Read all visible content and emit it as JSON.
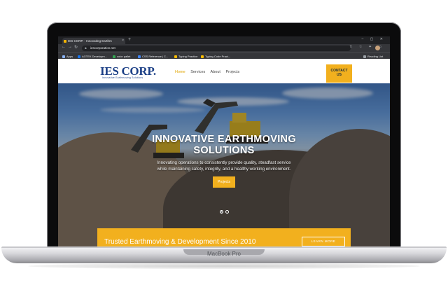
{
  "device": {
    "model": "MacBook Pro"
  },
  "browser": {
    "tab_title": "IES CORP. - Innovating Earthm",
    "new_tab": "+",
    "close": "×",
    "url": "iescorporation.net",
    "bookmarks": [
      {
        "label": "Apps",
        "color": "#8ab4f8"
      },
      {
        "label": "AGTEK Developm...",
        "color": "#1a73e8"
      },
      {
        "label": "color pallet",
        "color": "#34a853"
      },
      {
        "label": "CSS Reference | C...",
        "color": "#4285f4"
      },
      {
        "label": "Typing Practice",
        "color": "#fbbc04"
      },
      {
        "label": "Typing Code Pract...",
        "color": "#fbbc04"
      }
    ],
    "reading_list": "Reading List"
  },
  "site": {
    "logo": "IES CORP.",
    "tagline": "Innovative Earthmoving Solutions",
    "nav": [
      {
        "label": "Home",
        "active": true
      },
      {
        "label": "Services",
        "active": false
      },
      {
        "label": "About",
        "active": false
      },
      {
        "label": "Projects",
        "active": false
      }
    ],
    "contact_line1": "CONTACT",
    "contact_line2": "US",
    "hero": {
      "headline_line1": "INNOVATIVE EARTHMOVING",
      "headline_line2": "SOLUTIONS",
      "sub_line1": "Innovating operations to consistently provide quality, steadfast service",
      "sub_line2": "while maintaining safety, integrity, and a healthy working environment.",
      "button": "Projects",
      "slides": 2,
      "active_slide": 1
    },
    "band": {
      "text": "Trusted Earthmoving & Development Since 2010",
      "button": "LEARN MORE"
    },
    "colors": {
      "accent": "#f2b01e",
      "brand": "#1b3f86"
    }
  }
}
